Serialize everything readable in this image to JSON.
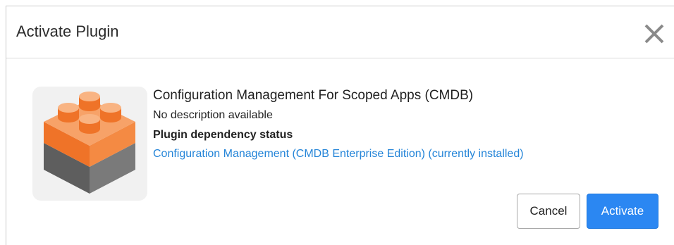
{
  "dialog": {
    "title": "Activate Plugin",
    "close_icon": "close-icon"
  },
  "plugin": {
    "icon": "lego-brick-icon",
    "name": "Configuration Management For Scoped Apps (CMDB)",
    "description": "No description available",
    "dependency_label": "Plugin dependency status",
    "dependency_link": "Configuration Management (CMDB Enterprise Edition) (currently installed)"
  },
  "buttons": {
    "cancel_label": "Cancel",
    "activate_label": "Activate"
  },
  "colors": {
    "accent": "#2b87f2",
    "link": "#2585d8",
    "brick_orange": "#f07a32",
    "brick_gray": "#6d6d6d"
  }
}
